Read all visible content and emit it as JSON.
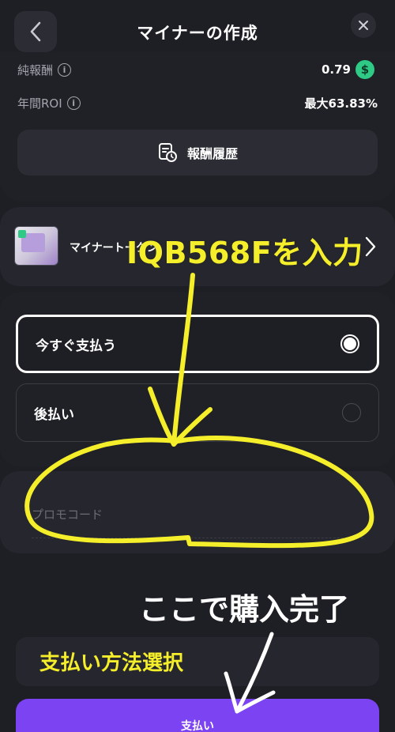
{
  "header": {
    "title": "マイナーの作成"
  },
  "summary": {
    "net_reward_label": "純報酬",
    "net_reward_value": "0.79",
    "annual_roi_label": "年間ROI",
    "annual_roi_value": "最大63.83%",
    "history_button_label": "報酬履歴"
  },
  "miner": {
    "name": "マイナートークン"
  },
  "payment": {
    "pay_now_label": "今すぐ支払う",
    "pay_later_label": "後払い"
  },
  "promo": {
    "placeholder": "プロモコード"
  },
  "pay_button": {
    "label": "支払い"
  },
  "annotations": {
    "promo_instruction": "IQB568Fを入力",
    "purchase_complete": "ここで購入完了",
    "payment_method": "支払い方法選択"
  },
  "colors": {
    "background": "#1e1f25",
    "accent": "#7b43f2",
    "highlight": "#f5ee2a",
    "usd_badge": "#2fca86"
  }
}
